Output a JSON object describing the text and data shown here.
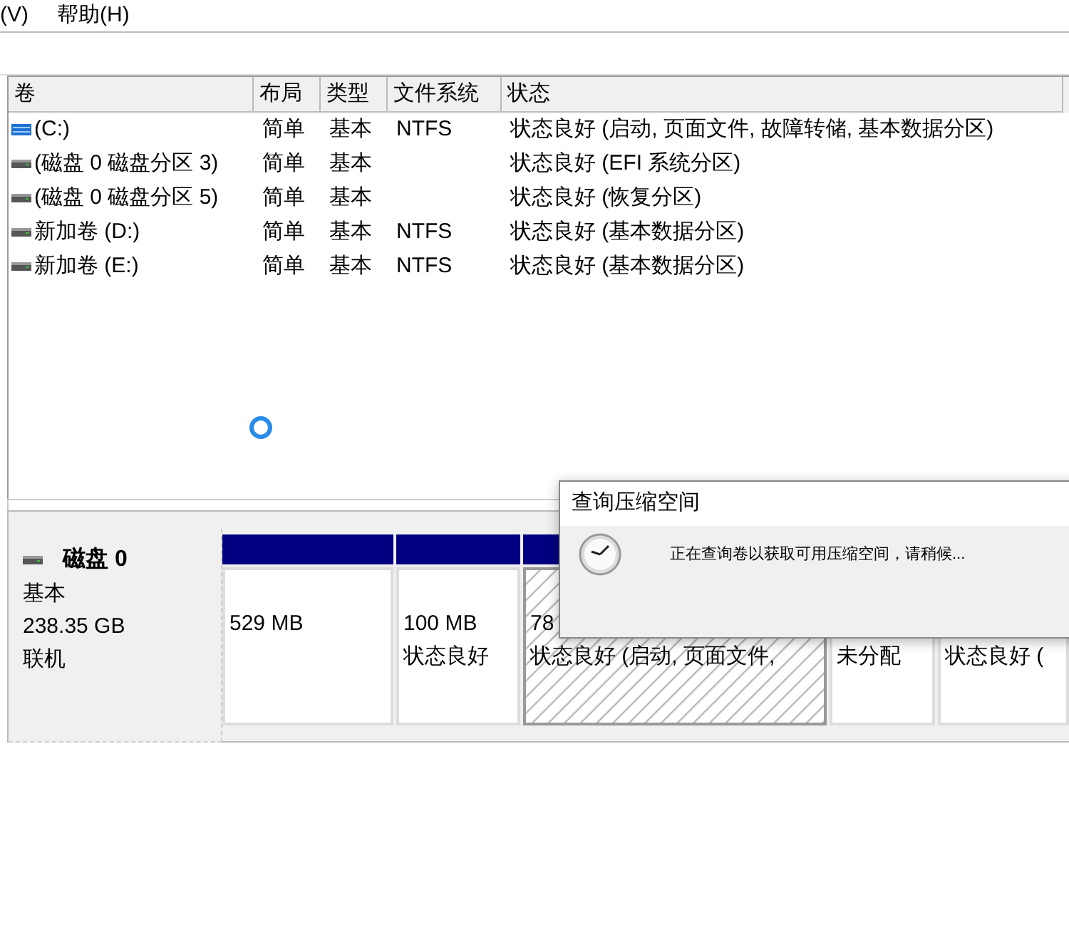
{
  "menu": [
    "(V)",
    "帮助(H)"
  ],
  "table": {
    "columns": [
      "卷",
      "布局",
      "类型",
      "文件系统",
      "状态"
    ],
    "rows": [
      {
        "kind": "system",
        "cells": [
          "(C:)",
          "简单",
          "基本",
          "NTFS",
          "状态良好 (启动, 页面文件, 故障转储, 基本数据分区)"
        ]
      },
      {
        "kind": "disk",
        "cells": [
          "(磁盘 0 磁盘分区 3)",
          "简单",
          "基本",
          "",
          "状态良好 (EFI 系统分区)"
        ]
      },
      {
        "kind": "disk",
        "cells": [
          "(磁盘 0 磁盘分区 5)",
          "简单",
          "基本",
          "",
          "状态良好 (恢复分区)"
        ]
      },
      {
        "kind": "disk",
        "cells": [
          "新加卷 (D:)",
          "简单",
          "基本",
          "NTFS",
          "状态良好 (基本数据分区)"
        ]
      },
      {
        "kind": "disk",
        "cells": [
          "新加卷 (E:)",
          "简单",
          "基本",
          "NTFS",
          "状态良好 (基本数据分区)"
        ]
      }
    ]
  },
  "disk": {
    "name": "磁盘 0",
    "type": "基本",
    "size": "238.35 GB",
    "status": "联机"
  },
  "partitions": [
    {
      "kind": "primary",
      "selected": false,
      "size": "529 MB"
    },
    {
      "kind": "primary",
      "selected": false,
      "size": "100 MB",
      "status": "状态良好"
    },
    {
      "kind": "primary",
      "selected": true,
      "size": "78",
      "status": "状态良好 (启动, 页面文件,"
    },
    {
      "kind": "unallocated",
      "selected": false,
      "status": "未分配"
    },
    {
      "kind": "primary",
      "selected": false,
      "status": "状态良好 ("
    }
  ],
  "dialog": {
    "title": "查询压缩空间",
    "message": "正在查询卷以获取可用压缩空间，请稍候..."
  }
}
